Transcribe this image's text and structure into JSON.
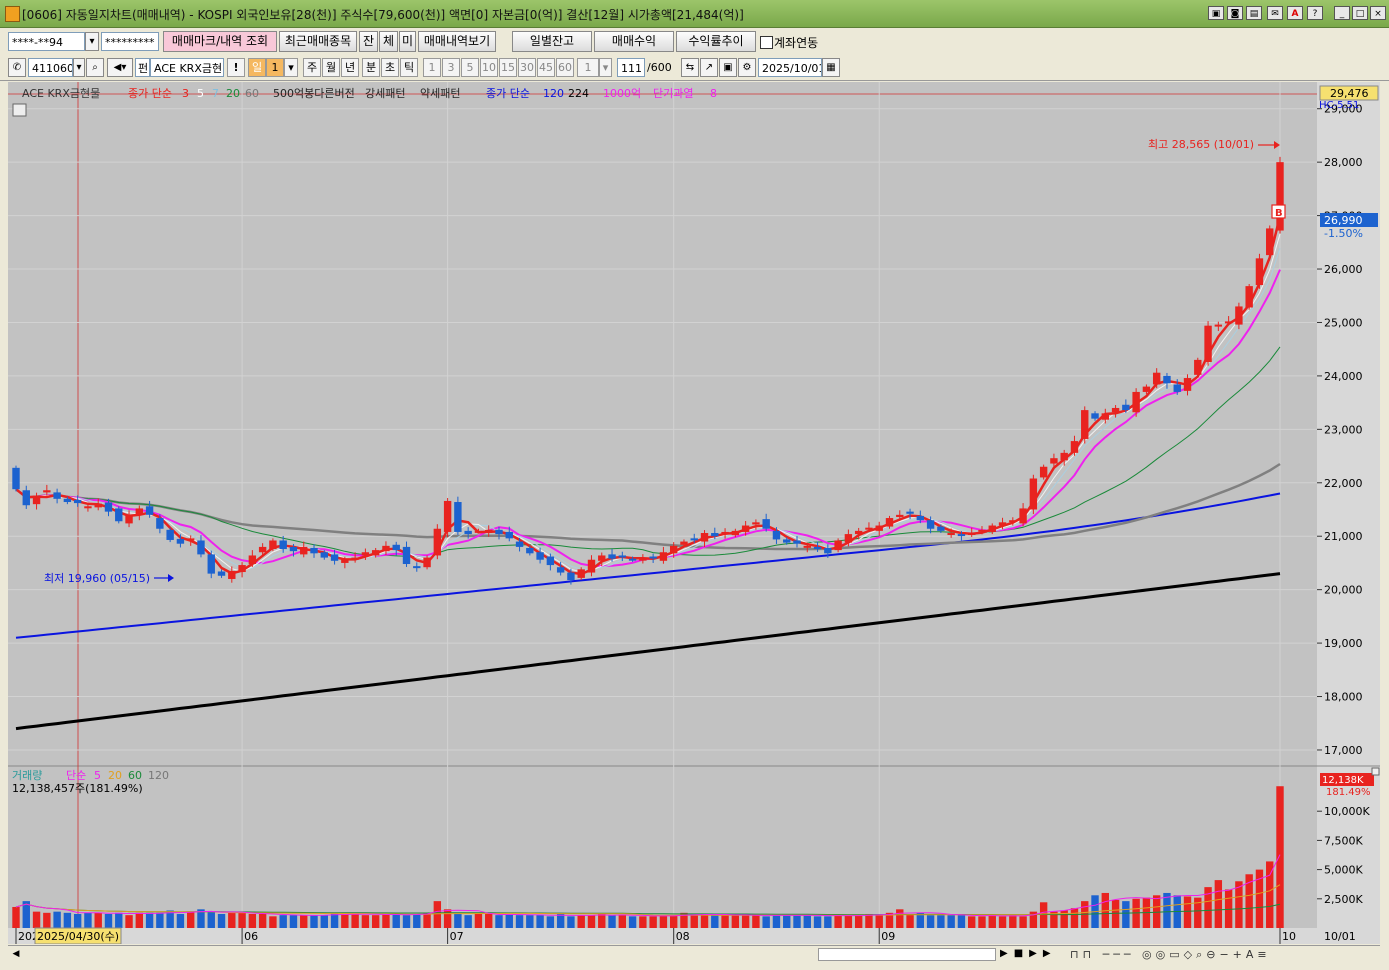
{
  "window": {
    "title": "[0606] 자동일지차트(매매내역) - KOSPI 외국인보유[28(천)] 주식수[79,600(천)] 액면[0] 자본금[0(억)] 결산[12월] 시가총액[21,484(억)]",
    "buttons": [
      "▣",
      "◙",
      "▤",
      "✉",
      "A",
      "?",
      "_",
      "□",
      "×"
    ]
  },
  "toolbar1": {
    "account": "****-**94",
    "password": "*********",
    "trade_mark_btn": "매매마크/내역 조회",
    "recent_btn": "최근매매종목",
    "jan_btn": "잔",
    "che_btn": "체",
    "mi_btn": "미",
    "history_btn": "매매내역보기",
    "daily_balance_btn": "일별잔고",
    "trade_profit_btn": "매매수익",
    "return_trend_btn": "수익률추이",
    "account_link_label": "계좌연동"
  },
  "toolbar2": {
    "code": "411060",
    "name_prefix": "펀",
    "name": "ACE KRX금현",
    "excl": "!",
    "periods": [
      "일",
      "1",
      "주",
      "월",
      "년",
      "분",
      "초",
      "틱"
    ],
    "minutes": [
      "1",
      "3",
      "5",
      "10",
      "15",
      "30",
      "45",
      "60"
    ],
    "count_value": "1",
    "bars": "111",
    "bars_total": "/600",
    "date": "2025/10/01"
  },
  "legend": {
    "name": "ACE KRX금현물",
    "ma_label": "종가 단순",
    "ma_periods": [
      "3",
      "5",
      "7",
      "20",
      "60"
    ],
    "pattern_text": "500억봉다른버전",
    "strong": "강세패턴",
    "weak": "약세패턴",
    "long_ma_label": "종가 단순",
    "long_ma_periods": [
      "120",
      "224"
    ],
    "amount": "1000억",
    "overheat": "단기과열",
    "overheat_val": "8"
  },
  "price_axis": {
    "labels": [
      "29,000",
      "28,000",
      "27,000",
      "26,000",
      "25,000",
      "24,000",
      "23,000",
      "22,000",
      "21,000",
      "20,000",
      "19,000",
      "18,000",
      "17,000"
    ],
    "top_box": "29,476",
    "top_partial": "HC-5.51",
    "current_box": "26,990",
    "current_pct": "-1.50%"
  },
  "annotations": {
    "high": "최고 28,565 (10/01)",
    "low": "최저 19,960 (05/15)",
    "buy_marker": "B"
  },
  "volume": {
    "legend_name": "거래량",
    "legend_ma": "단순",
    "legend_periods": [
      "5",
      "20",
      "60",
      "120"
    ],
    "value_text": "12,138,457주(181.49%)",
    "axis_labels": [
      "10,000K",
      "7,500K",
      "5,000K",
      "2,500K"
    ],
    "current_box": "12,138K",
    "current_pct": "181.49%"
  },
  "x_axis": {
    "labels": [
      "2025",
      "06",
      "07",
      "08",
      "09",
      "10",
      "10/01"
    ],
    "cursor_date": "2025/04/30(수)"
  },
  "colors": {
    "up": "#e8231f",
    "down": "#1c62cf",
    "chart_bg": "#c2c2c2",
    "axis_bg": "#d8d8d8",
    "ma3": "#e8231f",
    "ma5": "#f2f2f2",
    "ma7": "#aacfe0",
    "ma20": "#ee22ee",
    "ma60": "#1a8a3a",
    "ma120": "#808080",
    "ma224": "#0a14e0",
    "ma_long": "#000000"
  },
  "chart_data": {
    "type": "candlestick",
    "title": "ACE KRX금현물",
    "ylim": [
      16700,
      29500
    ],
    "x_tick_labels": [
      "2025",
      "06",
      "07",
      "08",
      "09",
      "10"
    ],
    "series": [
      {
        "name": "종가 단순 120",
        "values_start": 19100,
        "values_end": 21500
      },
      {
        "name": "종가 단순 224",
        "values_start": 17400,
        "values_end": 20300
      }
    ],
    "close": [
      21880,
      21580,
      21760,
      21860,
      21700,
      21640,
      21620,
      21560,
      21610,
      21460,
      21280,
      21400,
      21520,
      21400,
      21140,
      20930,
      20860,
      20960,
      20660,
      20300,
      20260,
      20350,
      20460,
      20640,
      20800,
      20920,
      20760,
      20720,
      20800,
      20680,
      20600,
      20540,
      20560,
      20600,
      20700,
      20740,
      20820,
      20740,
      20480,
      20420,
      20600,
      21140,
      21660,
      21080,
      21040,
      21100,
      21120,
      21040,
      20960,
      20800,
      20680,
      20560,
      20460,
      20320,
      20180,
      20380,
      20560,
      20640,
      20580,
      20620,
      20560,
      20580,
      20600,
      20700,
      20820,
      20900,
      20940,
      21060,
      21000,
      21080,
      21100,
      21200,
      21260,
      21140,
      20940,
      20880,
      20860,
      20820,
      20760,
      20680,
      20920,
      21040,
      21100,
      21160,
      21200,
      21340,
      21400,
      21420,
      21300,
      21140,
      21100,
      21060,
      21020,
      21060,
      21120,
      21200,
      21260,
      21300,
      21520,
      22080,
      22300,
      22460,
      22560,
      22780,
      23360,
      23200,
      23300,
      23400,
      23360,
      23700,
      23800,
      24060,
      23860,
      23700,
      23960,
      24300,
      24940,
      24960,
      25020,
      25300,
      25680,
      26200,
      26760,
      28000
    ],
    "volume_k": [
      1800,
      2300,
      1400,
      1300,
      1400,
      1300,
      1200,
      1300,
      1300,
      1200,
      1300,
      1100,
      1300,
      1300,
      1300,
      1500,
      1200,
      1400,
      1600,
      1400,
      1200,
      1300,
      1300,
      1200,
      1200,
      1000,
      1100,
      1100,
      1100,
      1100,
      1100,
      1300,
      1200,
      1200,
      1100,
      1100,
      1200,
      1200,
      1100,
      1200,
      1300,
      2300,
      1600,
      1200,
      1100,
      1200,
      1200,
      1100,
      1200,
      1100,
      1100,
      1100,
      1000,
      1200,
      1000,
      1100,
      1100,
      1200,
      1100,
      1100,
      1000,
      1000,
      1000,
      1100,
      1100,
      1300,
      1100,
      1200,
      1100,
      1100,
      1100,
      1100,
      1100,
      1000,
      1100,
      1100,
      1100,
      1100,
      1000,
      1000,
      1100,
      1100,
      1100,
      1200,
      1100,
      1300,
      1600,
      1200,
      1300,
      1100,
      1100,
      1100,
      1100,
      1000,
      1000,
      1100,
      1000,
      1100,
      1000,
      1400,
      2200,
      1400,
      1500,
      1700,
      2300,
      2800,
      3000,
      2400,
      2300,
      2500,
      2600,
      2800,
      3000,
      2800,
      2700,
      2600,
      3500,
      4100,
      3300,
      4000,
      4600,
      5000,
      5700,
      12138
    ]
  }
}
